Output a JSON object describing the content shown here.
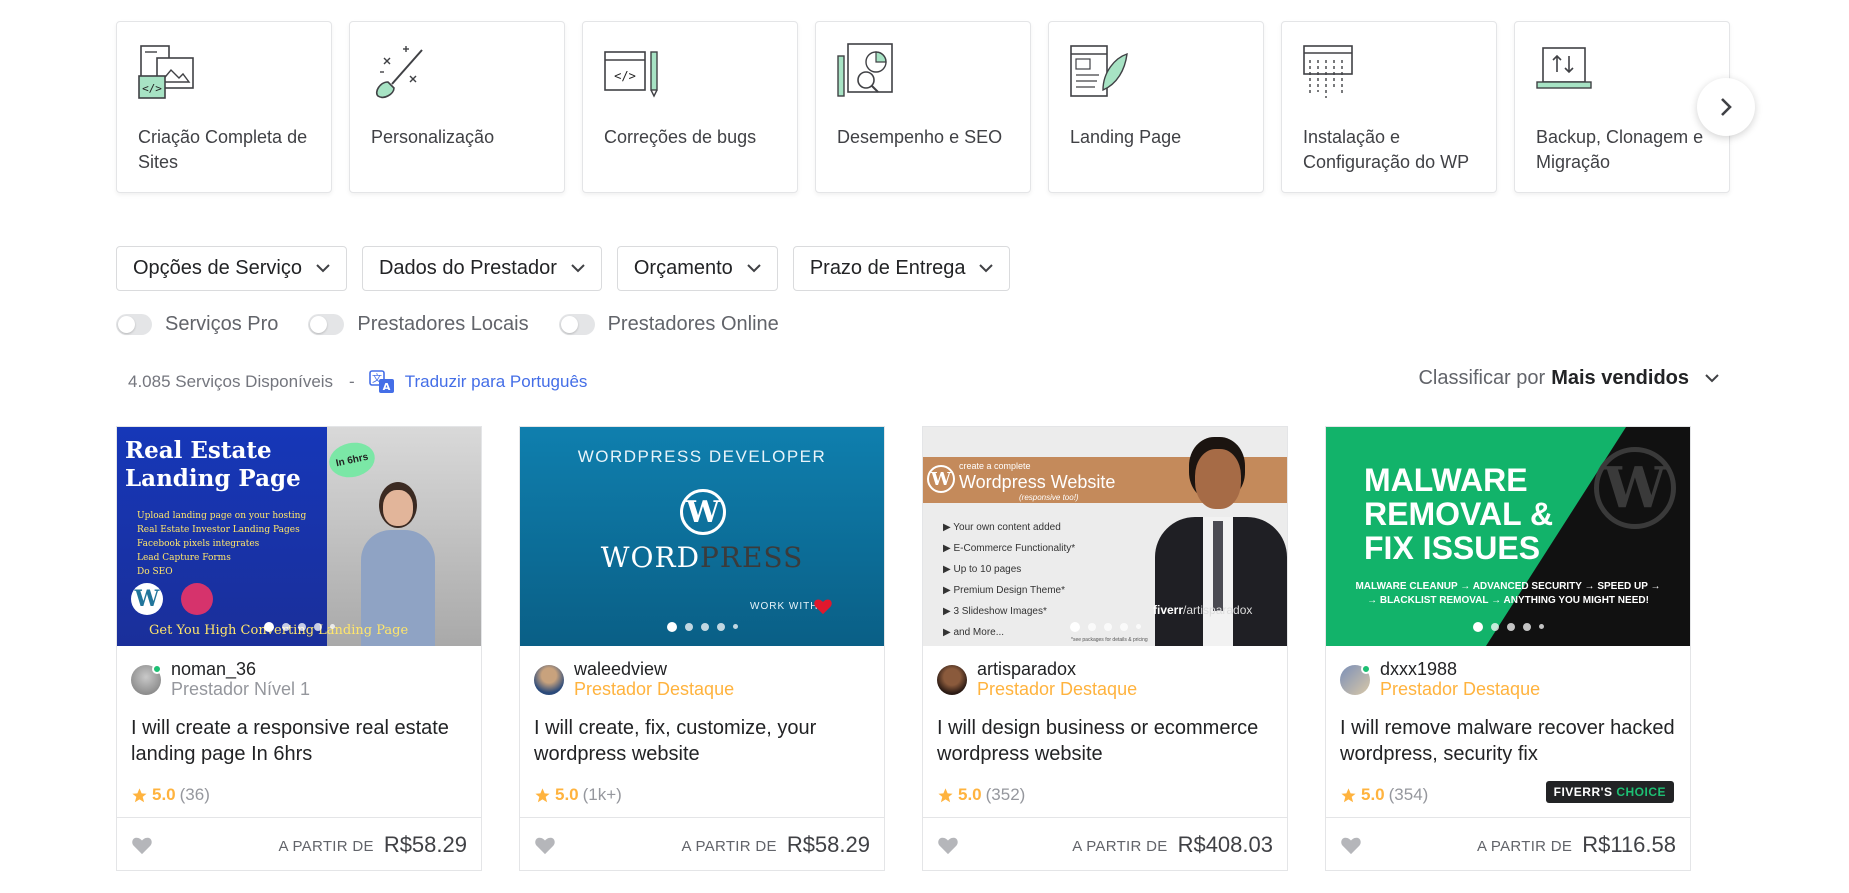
{
  "categories": [
    {
      "label": "Criação Completa de Sites",
      "icon": "website-creation-icon"
    },
    {
      "label": "Personalização",
      "icon": "brush-icon"
    },
    {
      "label": "Correções de bugs",
      "icon": "code-fix-icon"
    },
    {
      "label": "Desempenho e SEO",
      "icon": "seo-analytics-icon"
    },
    {
      "label": "Landing Page",
      "icon": "landing-page-icon"
    },
    {
      "label": "Instalação e Configuração do WP",
      "icon": "installation-icon"
    },
    {
      "label": "Backup, Clonagem e Migração",
      "icon": "migration-icon"
    }
  ],
  "filters": [
    "Opções de Serviço",
    "Dados do Prestador",
    "Orçamento",
    "Prazo de Entrega"
  ],
  "toggles": [
    "Serviços Pro",
    "Prestadores Locais",
    "Prestadores Online"
  ],
  "results": {
    "count": "4.085 Serviços Disponíveis",
    "separator": "-",
    "translate": "Traduzir para Português"
  },
  "sort": {
    "label": "Classificar por",
    "value": "Mais vendidos"
  },
  "gigs": [
    {
      "image": {
        "h1": "Real Estate",
        "h2": "Landing Page",
        "badge": "In 6hrs",
        "bullets": [
          "Upload landing page on your hosting",
          "Real Estate Investor Landing Pages",
          "Facebook pixels integrates",
          "Lead Capture Forms",
          "Do SEO"
        ],
        "caption": "Get You High Converting Landing Page"
      },
      "seller": "noman_36",
      "level": "Prestador Nível 1",
      "title": "I will create a responsive real estate landing page In 6hrs",
      "score": "5.0",
      "count": "(36)",
      "from": "A PARTIR DE",
      "price": "R$58.29",
      "badge": ""
    },
    {
      "image": {
        "top": "WORDPRESS DEVELOPER",
        "word_a": "WORD",
        "word_b": "PRESS",
        "work": "WORK WITH"
      },
      "seller": "waleedview",
      "level": "Prestador Destaque",
      "title": "I will create, fix, customize, your wordpress website",
      "score": "5.0",
      "count": "(1k+)",
      "from": "A PARTIR DE",
      "price": "R$58.29",
      "badge": ""
    },
    {
      "image": {
        "small": "create a complete",
        "headline": "Wordpress Website",
        "sub": "(responsive too!)",
        "bullets": [
          "Your own content added",
          "E-Commerce Functionality*",
          "Up to 10 pages",
          "Premium Design Theme*",
          "3 Slideshow Images*",
          "and More..."
        ],
        "brand": "fiverr",
        "handle": "/artisparadox",
        "note": "*see packages for details & pricing"
      },
      "seller": "artisparadox",
      "level": "Prestador Destaque",
      "title": "I will design business or ecommerce wordpress website",
      "score": "5.0",
      "count": "(352)",
      "from": "A PARTIR DE",
      "price": "R$408.03",
      "badge": ""
    },
    {
      "image": {
        "l1": "MALWARE",
        "l2": "REMOVAL &",
        "l3": "FIX ISSUES",
        "strip1": "MALWARE CLEANUP → ADVANCED SECURITY → SPEED UP →",
        "strip2": "→ BLACKLIST REMOVAL → ANYTHING YOU MIGHT NEED!"
      },
      "seller": "dxxx1988",
      "level": "Prestador Destaque",
      "title": "I will remove malware recover hacked wordpress, security fix",
      "score": "5.0",
      "count": "(354)",
      "from": "A PARTIR DE",
      "price": "R$116.58",
      "badge": "FIVERR'S",
      "badge_b": "CHOICE"
    }
  ],
  "colors": {
    "accent": "#1dbf73",
    "star": "#ffb33e",
    "link": "#446ee7"
  }
}
